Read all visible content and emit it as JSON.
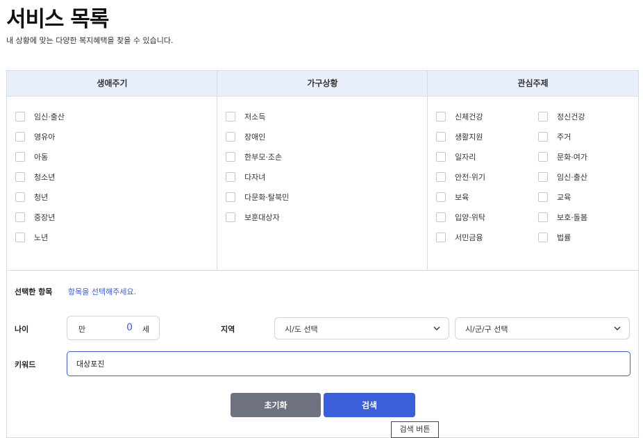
{
  "page": {
    "title": "서비스 목록",
    "description": "내 상황에 맞는 다양한 복지혜택을 찾을 수 있습니다."
  },
  "categories": {
    "life_cycle": {
      "header": "생애주기",
      "items": [
        "임신·출산",
        "영유아",
        "아동",
        "청소년",
        "청년",
        "중장년",
        "노년"
      ]
    },
    "household": {
      "header": "가구상황",
      "items": [
        "저소득",
        "장애인",
        "한부모·조손",
        "다자녀",
        "다문화·탈북민",
        "보훈대상자"
      ]
    },
    "interest": {
      "header": "관심주제",
      "items_left": [
        "신체건강",
        "생활지원",
        "일자리",
        "안전·위기",
        "보육",
        "입양·위탁",
        "서민금융"
      ],
      "items_right": [
        "정신건강",
        "주거",
        "문화·여가",
        "임신·출산",
        "교육",
        "보호·돌봄",
        "법률"
      ]
    }
  },
  "selection": {
    "label": "선택한 항목",
    "hint": "항목을 선택해주세요."
  },
  "age": {
    "label": "나이",
    "prefix": "만",
    "value": "0",
    "suffix": "세"
  },
  "region": {
    "label": "지역",
    "sido_placeholder": "시/도 선택",
    "sigungu_placeholder": "시/군/구 선택"
  },
  "keyword": {
    "label": "키워드",
    "value": "대상포진"
  },
  "buttons": {
    "reset": "초기화",
    "search": "검색"
  },
  "tooltip": {
    "text": "검색 버튼"
  },
  "colors": {
    "accent": "#3b5fd9",
    "header_bg": "#eaf0fb",
    "reset_button": "#6e717f",
    "hint_text": "#3b5bdb"
  }
}
